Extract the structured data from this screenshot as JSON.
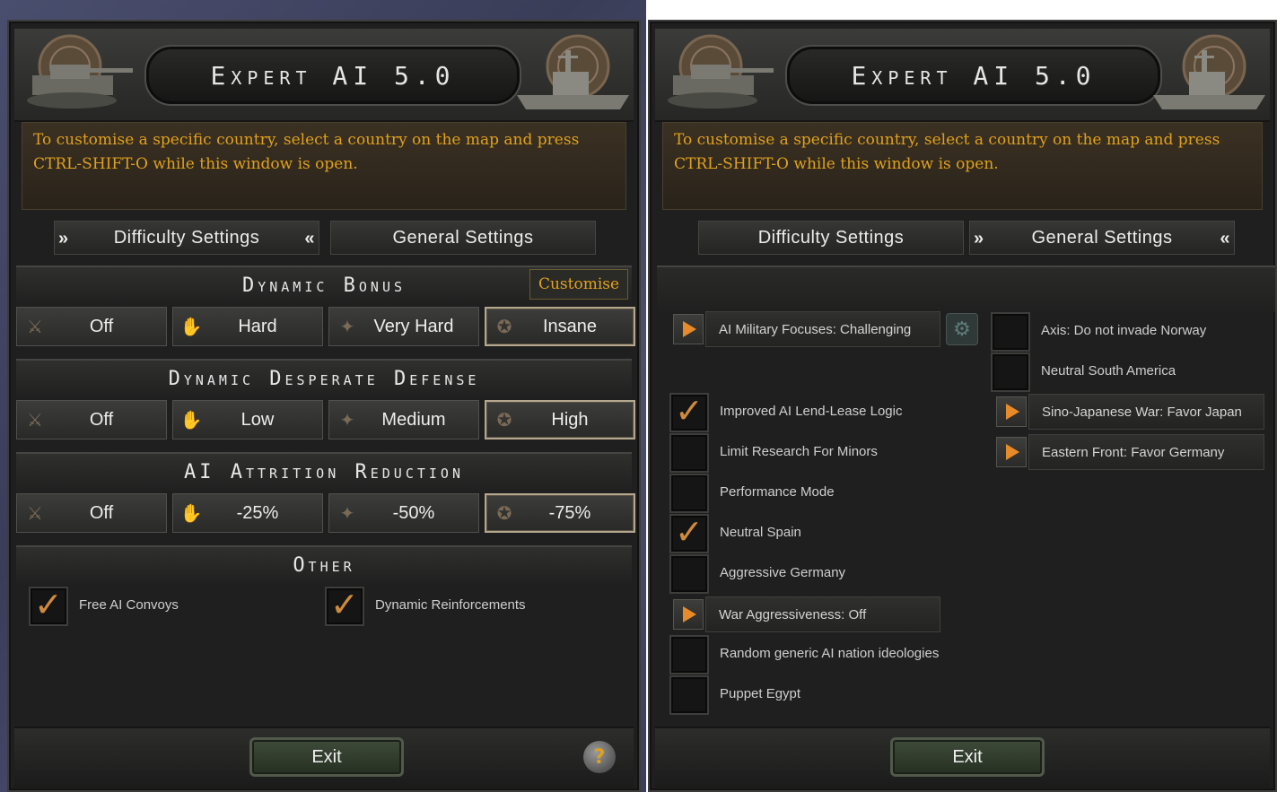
{
  "title": "Expert AI 5.0",
  "info_text_line1": "To customise a specific country, select a country on the map and press",
  "info_text_line2": "CTRL-SHIFT-O while this window is open.",
  "tabs": {
    "difficulty": "Difficulty Settings",
    "general": "General Settings"
  },
  "left": {
    "sections": {
      "dynamic_bonus": "Dynamic Bonus",
      "desperate_defense": "Dynamic Desperate Defense",
      "attrition": "AI Attrition Reduction",
      "other": "Other"
    },
    "customise_label": "Customise",
    "bonus_options": [
      "Off",
      "Hard",
      "Very Hard",
      "Insane"
    ],
    "defense_options": [
      "Off",
      "Low",
      "Medium",
      "High"
    ],
    "attrition_options": [
      "Off",
      "-25%",
      "-50%",
      "-75%"
    ],
    "other_checks": [
      {
        "label": "Free AI Convoys",
        "checked": true
      },
      {
        "label": "Dynamic Reinforcements",
        "checked": true
      }
    ],
    "exit_label": "Exit",
    "help_label": "?"
  },
  "right": {
    "dropdown_military": "AI Military Focuses: Challenging",
    "dropdown_war": "War Aggressiveness: Off",
    "dropdown_sino": "Sino-Japanese War: Favor Japan",
    "dropdown_eastern": "Eastern Front: Favor Germany",
    "checks": [
      {
        "label": "Improved AI Lend-Lease Logic",
        "checked": true
      },
      {
        "label": "Limit Research For Minors",
        "checked": false
      },
      {
        "label": "Performance Mode",
        "checked": false
      },
      {
        "label": "Neutral Spain",
        "checked": true
      },
      {
        "label": "Aggressive Germany",
        "checked": false
      },
      {
        "label": "Random generic AI nation ideologies",
        "checked": false
      },
      {
        "label": "Puppet Egypt",
        "checked": false
      }
    ],
    "right_checks": [
      {
        "label": "Axis: Do not invade Norway",
        "checked": false
      },
      {
        "label": "Neutral South America",
        "checked": false
      }
    ],
    "exit_label": "Exit"
  },
  "colors": {
    "accent": "#e2a21c",
    "checkmark": "#d08a3c",
    "play": "#e88a2a"
  }
}
